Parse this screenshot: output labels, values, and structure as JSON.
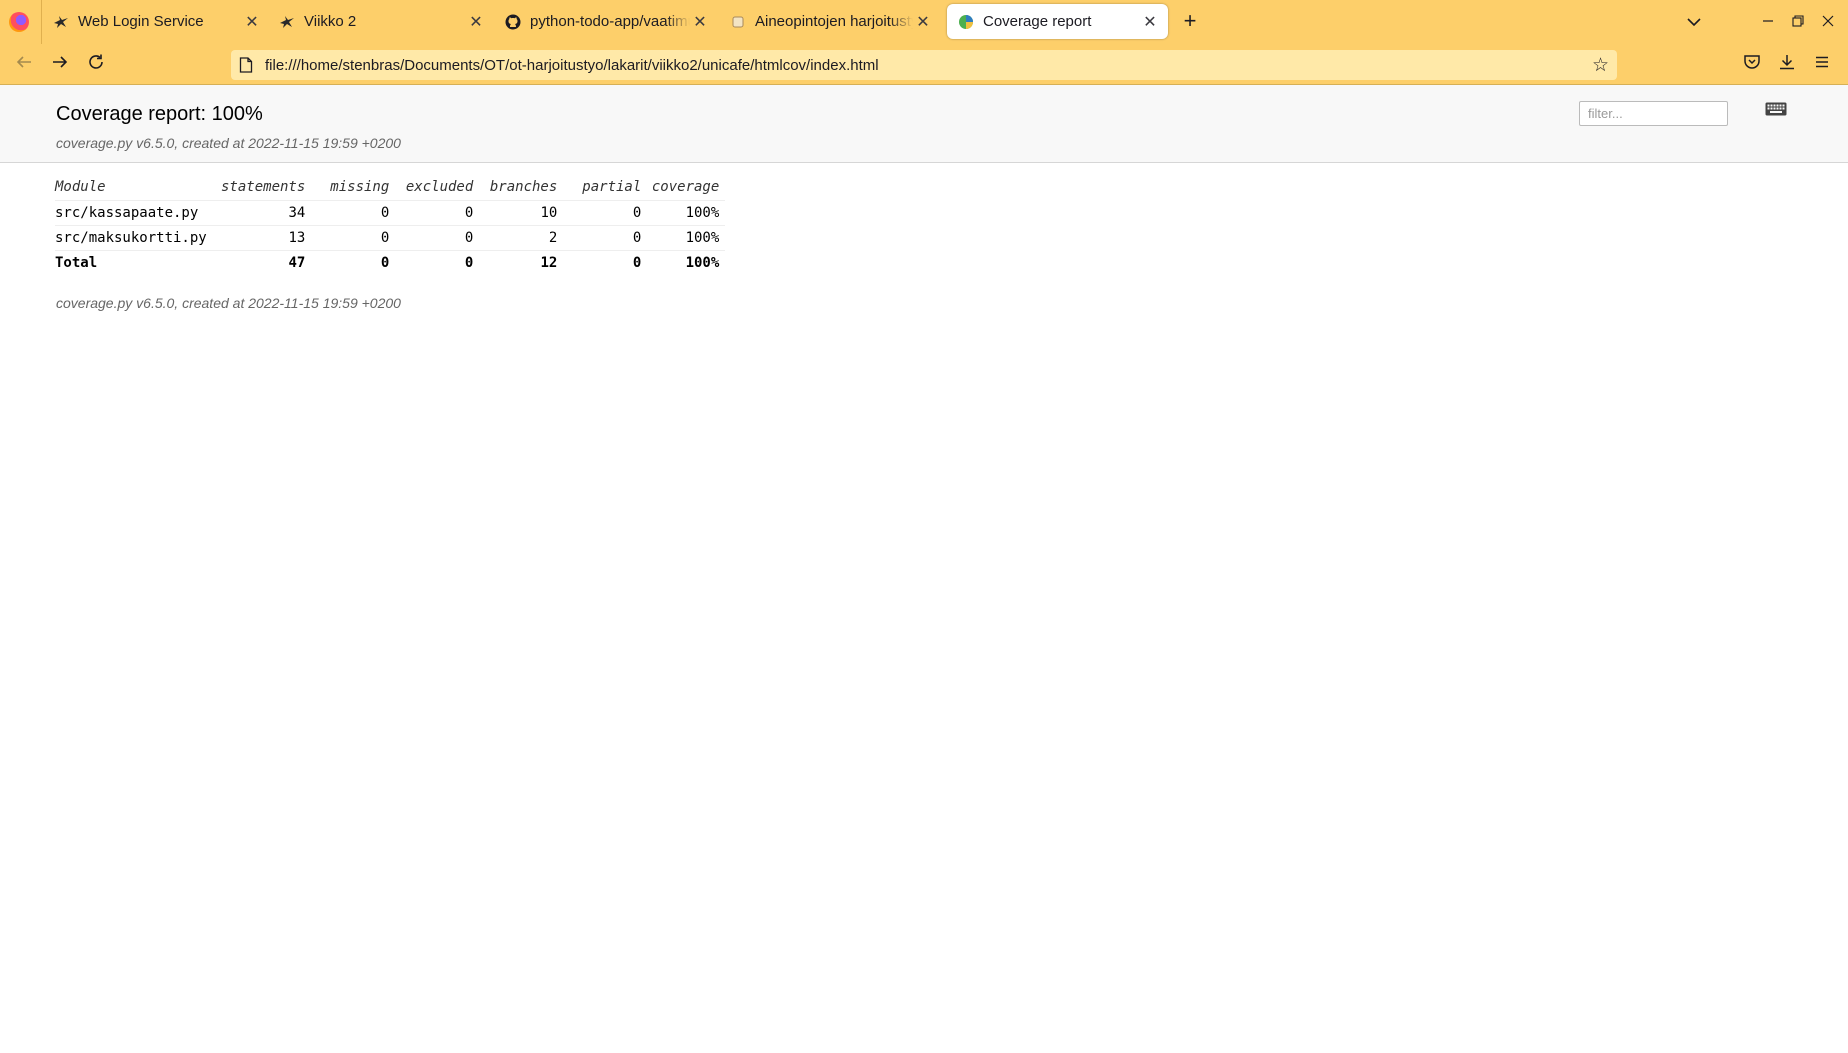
{
  "browser": {
    "tabs": [
      {
        "title": "Web Login Service",
        "icon": "haka-bird-icon"
      },
      {
        "title": "Viikko 2",
        "icon": "haka-bird-icon"
      },
      {
        "title": "python-todo-app/vaatimuks",
        "icon": "github-icon"
      },
      {
        "title": "Aineopintojen harjoitustyö",
        "icon": "course-icon"
      },
      {
        "title": "Coverage report",
        "icon": "coverage-icon",
        "active": true
      }
    ],
    "url": "file:///home/stenbras/Documents/OT/ot-harjoitustyo/lakarit/viikko2/unicafe/htmlcov/index.html",
    "accent_color": "#fdcf6a"
  },
  "report": {
    "title": "Coverage report: 100%",
    "meta": "coverage.py v6.5.0, created at 2022-11-15 19:59 +0200",
    "filter_placeholder": "filter...",
    "columns": [
      "Module",
      "statements",
      "missing",
      "excluded",
      "branches",
      "partial",
      "coverage"
    ],
    "rows": [
      [
        "src/kassapaate.py",
        "34",
        "0",
        "0",
        "10",
        "0",
        "100%"
      ],
      [
        "src/maksukortti.py",
        "13",
        "0",
        "0",
        "2",
        "0",
        "100%"
      ]
    ],
    "total": [
      "Total",
      "47",
      "0",
      "0",
      "12",
      "0",
      "100%"
    ],
    "footer": "coverage.py v6.5.0, created at 2022-11-15 19:59 +0200"
  }
}
